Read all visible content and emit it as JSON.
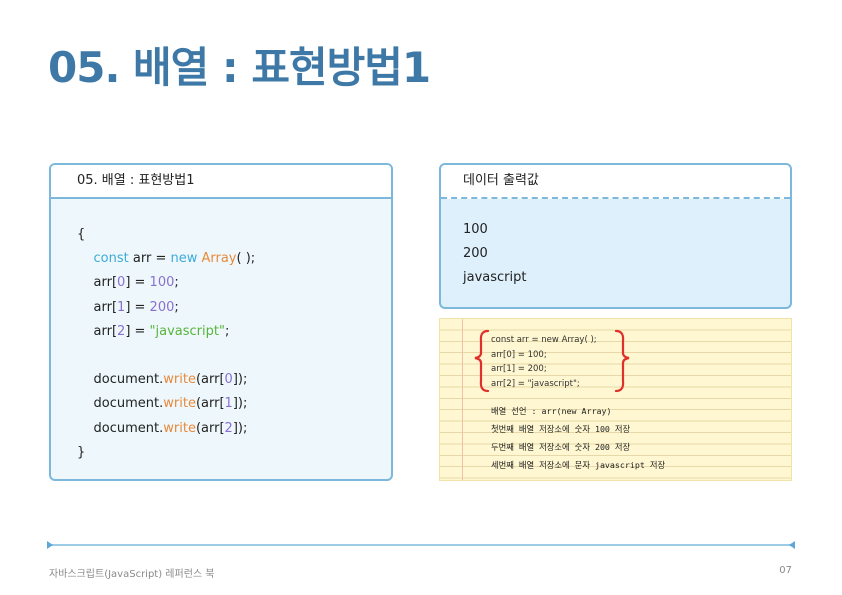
{
  "title": "05. 배열 : 표현방법1",
  "code_panel": {
    "header": "05. 배열 : 표현방법1",
    "open_brace": "{",
    "line1": {
      "kw": "const",
      "plain1": " arr = ",
      "kw2": "new",
      "plain2": " ",
      "type": "Array",
      "plain3": "( );"
    },
    "line2": {
      "plain1": "arr[",
      "idx": "0",
      "plain2": "] = ",
      "num": "100",
      "plain3": ";"
    },
    "line3": {
      "plain1": "arr[",
      "idx": "1",
      "plain2": "] = ",
      "num": "200",
      "plain3": ";"
    },
    "line4": {
      "plain1": "arr[",
      "idx": "2",
      "plain2": "] = ",
      "str": "\"javascript\"",
      "plain3": ";"
    },
    "write1": {
      "obj": "document.",
      "fn": "write",
      "plain1": "(arr[",
      "idx": "0",
      "plain2": "]);"
    },
    "write2": {
      "obj": "document.",
      "fn": "write",
      "plain1": "(arr[",
      "idx": "1",
      "plain2": "]);"
    },
    "write3": {
      "obj": "document.",
      "fn": "write",
      "plain1": "(arr[",
      "idx": "2",
      "plain2": "]);"
    },
    "close_brace": "}"
  },
  "output_panel": {
    "header": "데이터 출력값",
    "values": [
      "100",
      "200",
      "javascript"
    ]
  },
  "note": {
    "code_lines": [
      "const arr = new Array( );",
      "arr[0] = 100;",
      "arr[1] = 200;",
      "arr[2] = \"javascript\";"
    ],
    "hand_lines": [
      "배열 선언 : arr(new Array)",
      "첫번째 배열 저장소에 숫자 100 저장",
      "두번째 배열 저장소에 숫자 200 저장",
      "세번째 배열 저장소에 문자 javascript 저장"
    ]
  },
  "footer": {
    "book_title": "자바스크립트(JavaScript) 레퍼런스 북",
    "page_number": "07"
  },
  "colors": {
    "title": "#3d78a6",
    "border": "#7cb7dc",
    "keyword": "#3daad8",
    "type": "#e8893a",
    "number": "#8a6fd0",
    "string": "#58b43a",
    "brace_red": "#e0302b"
  }
}
